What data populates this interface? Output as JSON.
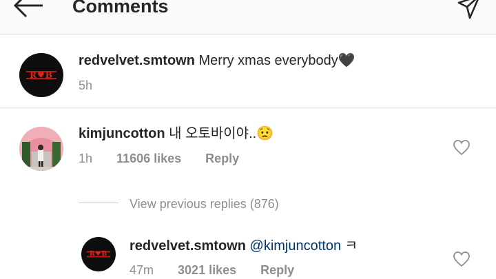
{
  "header": {
    "title": "Comments",
    "back_icon": "arrow-left-icon",
    "send_icon": "paper-plane-icon"
  },
  "caption": {
    "username": "redvelvet.smtown",
    "text": "Merry xmas everybody",
    "emoji": "🖤",
    "time": "5h",
    "avatar_logo_text": "R♥B"
  },
  "comment": {
    "username": "kimjuncotton",
    "text": "내 오토바이야..",
    "emoji": "😟",
    "time": "1h",
    "likes": "11606 likes",
    "reply_label": "Reply"
  },
  "view_replies": "View previous replies (876)",
  "reply": {
    "username": "redvelvet.smtown",
    "mention": "@kimjuncotton",
    "text": "ㅋ",
    "time": "47m",
    "likes": "3021 likes",
    "reply_label": "Reply",
    "avatar_logo_text": "R♥B"
  },
  "colors": {
    "text": "#262626",
    "secondary": "#8e8e8e",
    "mention": "#003569",
    "header_bg": "#fafafa"
  }
}
